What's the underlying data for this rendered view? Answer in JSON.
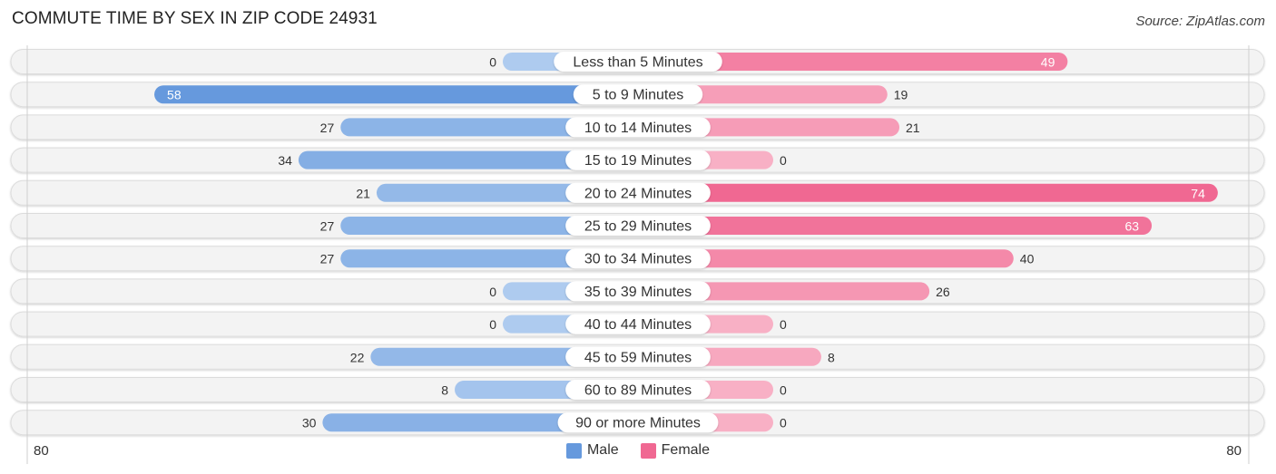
{
  "title": "COMMUTE TIME BY SEX IN ZIP CODE 24931",
  "source": "Source: ZipAtlas.com",
  "colors": {
    "male": "#6699dd",
    "male_light": "#aecbef",
    "female": "#f06892",
    "female_light": "#f8b0c5"
  },
  "chart_data": {
    "type": "bar",
    "orientation": "horizontal-diverging",
    "title": "COMMUTE TIME BY SEX IN ZIP CODE 24931",
    "categories": [
      "Less than 5 Minutes",
      "5 to 9 Minutes",
      "10 to 14 Minutes",
      "15 to 19 Minutes",
      "20 to 24 Minutes",
      "25 to 29 Minutes",
      "30 to 34 Minutes",
      "35 to 39 Minutes",
      "40 to 44 Minutes",
      "45 to 59 Minutes",
      "60 to 89 Minutes",
      "90 or more Minutes"
    ],
    "series": [
      {
        "name": "Male",
        "values": [
          0,
          58,
          27,
          34,
          21,
          27,
          27,
          0,
          0,
          22,
          8,
          30
        ]
      },
      {
        "name": "Female",
        "values": [
          49,
          19,
          21,
          0,
          74,
          63,
          40,
          26,
          0,
          8,
          0,
          0
        ]
      }
    ],
    "axis": {
      "left_max": 80,
      "right_max": 80,
      "left_label": "80",
      "right_label": "80"
    },
    "legend": {
      "position": "bottom-center",
      "entries": [
        "Male",
        "Female"
      ]
    },
    "grid": false
  }
}
